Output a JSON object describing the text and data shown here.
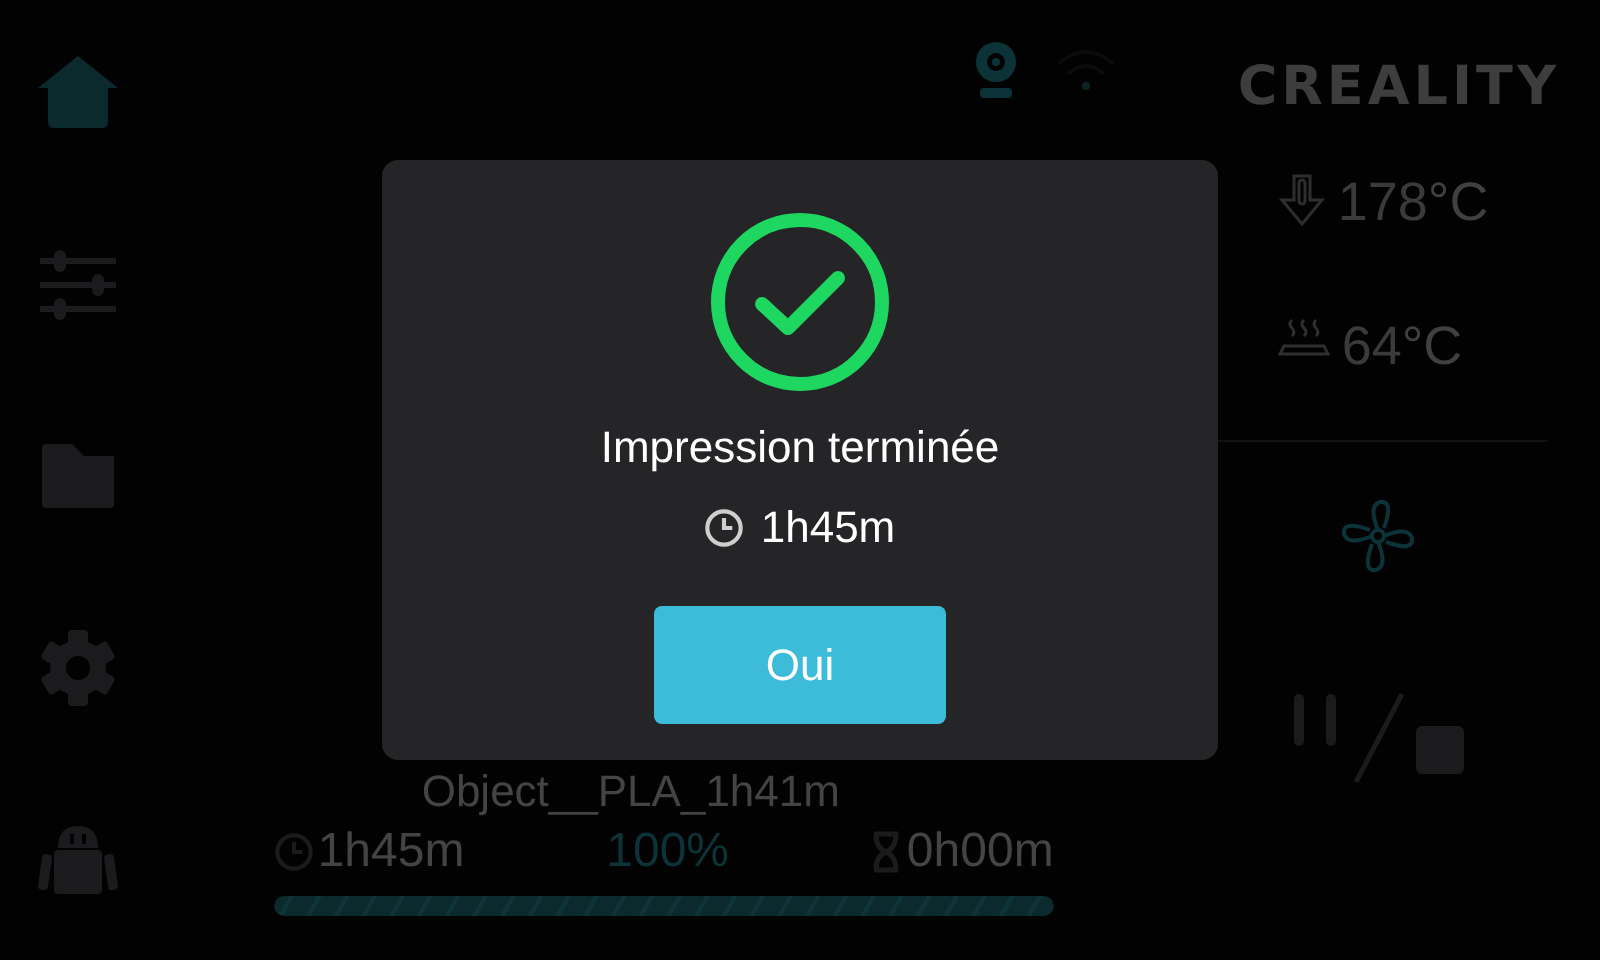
{
  "sidebar": {
    "items": [
      {
        "kind": "home",
        "selected": true
      },
      {
        "kind": "tune",
        "selected": false
      },
      {
        "kind": "files",
        "selected": false
      },
      {
        "kind": "settings",
        "selected": false
      },
      {
        "kind": "assistant",
        "selected": false
      }
    ]
  },
  "brand": {
    "logo": "CREALITY"
  },
  "temperatures": [
    {
      "kind": "nozzle",
      "value": "178",
      "unit": "°C"
    },
    {
      "kind": "bed",
      "value": "64",
      "unit": "°C"
    }
  ],
  "job": {
    "filename": "Object__PLA_1h41m",
    "elapsed": "1h45m",
    "percent": "100",
    "percent_sign": "%",
    "remaining": "0h00m",
    "level": 1
  },
  "dialog": {
    "title": "Impression terminée",
    "duration": "1h45m",
    "button": "Oui"
  }
}
